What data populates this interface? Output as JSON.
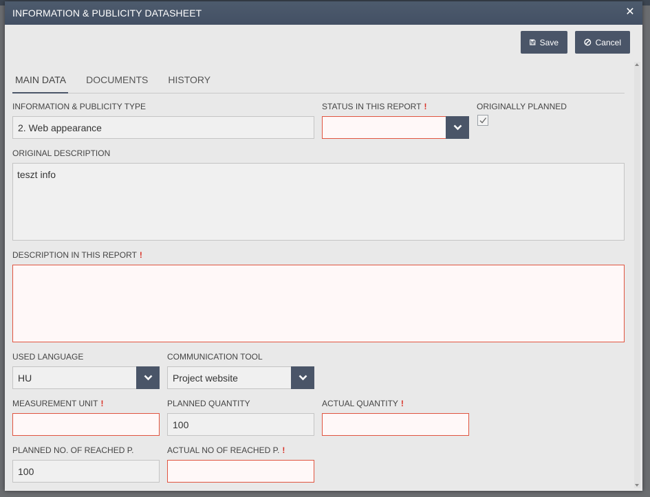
{
  "window": {
    "title": "INFORMATION & PUBLICITY DATASHEET"
  },
  "toolbar": {
    "save_label": "Save",
    "cancel_label": "Cancel"
  },
  "tabs": [
    {
      "label": "MAIN DATA",
      "active": true
    },
    {
      "label": "DOCUMENTS",
      "active": false
    },
    {
      "label": "HISTORY",
      "active": false
    }
  ],
  "form": {
    "ip_type": {
      "label": "INFORMATION & PUBLICITY TYPE",
      "value": "2. Web appearance"
    },
    "status": {
      "label": "STATUS IN THIS REPORT",
      "required_mark": "!",
      "value": ""
    },
    "originally_planned": {
      "label": "ORIGINALLY PLANNED",
      "checked": true
    },
    "original_description": {
      "label": "ORIGINAL DESCRIPTION",
      "value": "teszt info"
    },
    "description_report": {
      "label": "DESCRIPTION IN THIS REPORT",
      "required_mark": "!",
      "value": ""
    },
    "used_language": {
      "label": "USED LANGUAGE",
      "value": "HU"
    },
    "communication_tool": {
      "label": "COMMUNICATION TOOL",
      "value": "Project website"
    },
    "measurement_unit": {
      "label": "MEASUREMENT UNIT",
      "required_mark": "!",
      "value": ""
    },
    "planned_quantity": {
      "label": "PLANNED QUANTITY",
      "value": "100"
    },
    "actual_quantity": {
      "label": "ACTUAL QUANTITY",
      "required_mark": "!",
      "value": ""
    },
    "planned_reached": {
      "label": "PLANNED NO. OF REACHED P.",
      "value": "100"
    },
    "actual_reached": {
      "label": "ACTUAL NO OF REACHED P.",
      "required_mark": "!",
      "value": ""
    }
  },
  "colors": {
    "header": "#4a5568",
    "required": "#d93025",
    "background": "#e9e9e9"
  },
  "icons": {
    "close": "close-icon",
    "save": "floppy-disk-icon",
    "cancel": "ban-icon",
    "dropdown": "chevron-down-icon",
    "check": "checkmark-icon"
  }
}
